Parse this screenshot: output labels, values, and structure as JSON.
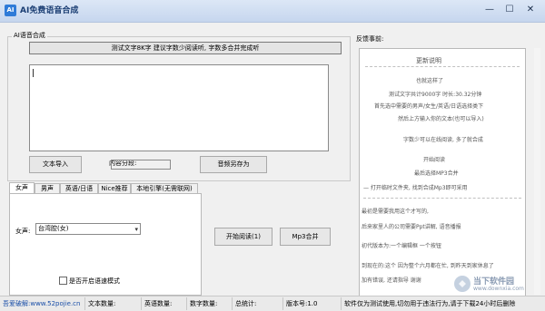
{
  "window": {
    "title": "AI免费语音合成",
    "icon_text": "AI",
    "min_glyph": "—",
    "max_glyph": "☐",
    "close_glyph": "✕"
  },
  "synth": {
    "group_title": "AI语音合成",
    "banner": "测试文字8K字 建议字数少阅读听, 字数多合并完成听",
    "text_value": "",
    "import_button": "文本导入",
    "segment_label": "内容分段:",
    "save_audio_button": "音频另存为"
  },
  "tabs": [
    {
      "label": "女声",
      "active": true
    },
    {
      "label": "男声",
      "active": false
    },
    {
      "label": "英语/日语",
      "active": false
    },
    {
      "label": "Nice推荐",
      "active": false
    },
    {
      "label": "本地引擎(无需联网)",
      "active": false
    }
  ],
  "voice": {
    "label": "女声:",
    "selected": "台湾腔(女)",
    "fast_mode_label": "是否开启语速模式",
    "fast_mode_checked": false
  },
  "actions": {
    "read_button": "开始阅读(1)",
    "merge_button": "Mp3合并"
  },
  "notes": {
    "group_title": "反馈事前:",
    "heading": "更新说明",
    "lines": [
      "也就这样了",
      "测试文字共计9000字 时长:30.32分钟",
      "首先选中需要的男声/女生/英语/日语选择类下",
      "然后上方输入你的文本(也可以导入)",
      "字数少可以在线阅读, 多了就合成",
      "开始阅读",
      "最后选择MP3合并",
      "— 打开临时文件夹, 找到合成Mp3即可采用"
    ],
    "footer_lines": [
      "最初是需要我用这个才写的,",
      "后来家里人的公司需要Ppt讲解, 语音播报",
      "初代版本为:一个编辑框 一个按钮",
      "到现在的:这个 因为整个六月都在忙, 到昨天到家休息了",
      "加有错误, 还请指导 谢谢"
    ]
  },
  "status": {
    "link": "吾爱破解:www.52pojie.cn",
    "text_count": "文本数量:",
    "english_count": "英语数量:",
    "number_count": "数字数量:",
    "total": "总统计:",
    "version": "版本号:1.0",
    "notice": "软件仅为测试使用,切勿用于违法行为,请于下载24小时后删除"
  },
  "watermark": {
    "name": "当下软件园",
    "url": "www.downxia.com"
  },
  "colors": {
    "title_text": "#1b3e73",
    "link": "#1a4fa8"
  }
}
